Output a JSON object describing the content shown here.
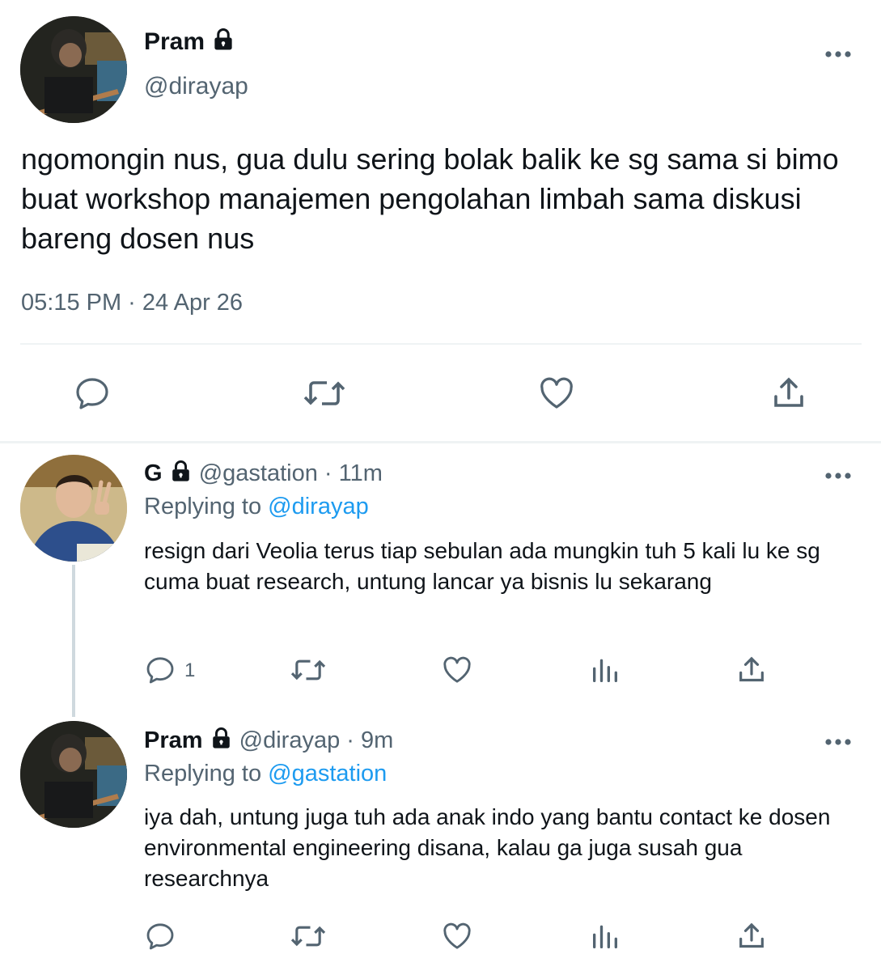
{
  "main_tweet": {
    "author_name": "Pram",
    "handle": "@dirayap",
    "text": "ngomongin nus, gua dulu sering bolak balik ke sg sama si bimo buat workshop manajemen pengolahan limbah sama diskusi bareng dosen nus",
    "timestamp": "05:15 PM · 24 Apr 26",
    "icons": [
      "lock-icon",
      "more-icon",
      "reply-icon",
      "retweet-icon",
      "like-icon",
      "share-icon"
    ]
  },
  "replies": [
    {
      "author_name": "G",
      "handle": "@gastation",
      "separator": "·",
      "time": "11m",
      "replying_prefix": "Replying to",
      "replying_to": "@dirayap",
      "text": "resign dari Veolia terus tiap sebulan ada mungkin tuh 5 kali lu ke sg cuma buat research, untung lancar ya bisnis lu sekarang",
      "reply_count": "1"
    },
    {
      "author_name": "Pram",
      "handle": "@dirayap",
      "separator": "·",
      "time": "9m",
      "replying_prefix": "Replying to",
      "replying_to": "@gastation",
      "text": "iya dah, untung juga tuh ada anak indo yang bantu contact ke dosen environmental engineering disana, kalau ga juga susah gua researchnya",
      "reply_count": ""
    }
  ],
  "colors": {
    "text": "#0f1419",
    "secondary": "#536471",
    "link": "#1d9bf0",
    "divider": "#eff3f4",
    "thread_line": "#cfd9de"
  }
}
